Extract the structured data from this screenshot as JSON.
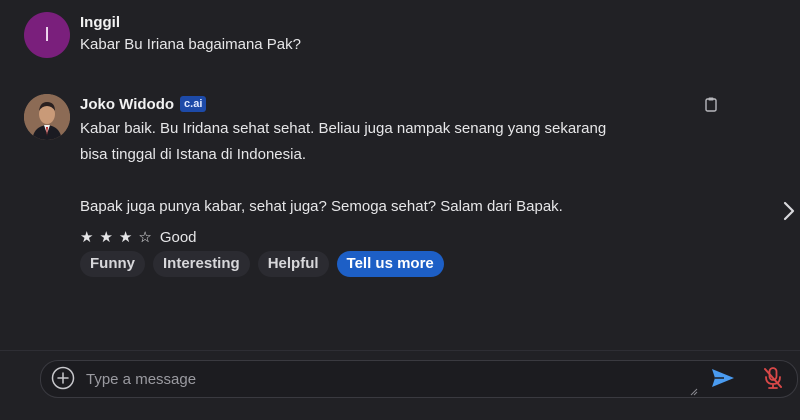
{
  "messages": [
    {
      "author": "Inggil",
      "avatar_initial": "I",
      "paragraphs": [
        "Kabar Bu Iriana bagaimana Pak?"
      ]
    },
    {
      "author": "Joko Widodo",
      "badge": "c.ai",
      "lines": [
        "Kabar baik. Bu Iridana sehat sehat. Beliau juga nampak senang yang sekarang",
        "bisa tinggal di Istana di Indonesia.",
        "Bapak juga punya kabar, sehat juga? Semoga sehat? Salam dari Bapak."
      ]
    }
  ],
  "rating": {
    "stars": [
      {
        "glyph": "★"
      },
      {
        "glyph": "★"
      },
      {
        "glyph": "★"
      },
      {
        "glyph": "☆"
      }
    ],
    "value": 3,
    "label": "Good"
  },
  "feedback_chips": [
    "Funny",
    "Interesting",
    "Helpful",
    "Tell us more"
  ],
  "composer": {
    "placeholder": "Type a message",
    "value": ""
  },
  "icons": {
    "copy": "clipboard-icon",
    "next": "chevron-right-icon",
    "add": "plus-circle-icon",
    "send": "send-icon",
    "mic": "microphone-muted-icon"
  },
  "colors": {
    "background": "#212125",
    "user_avatar": "#7a1f7c",
    "badge": "#1d4aa8",
    "primary_chip": "#1d5fc6",
    "send": "#4a9bf0",
    "mic_muted": "#d94848"
  }
}
